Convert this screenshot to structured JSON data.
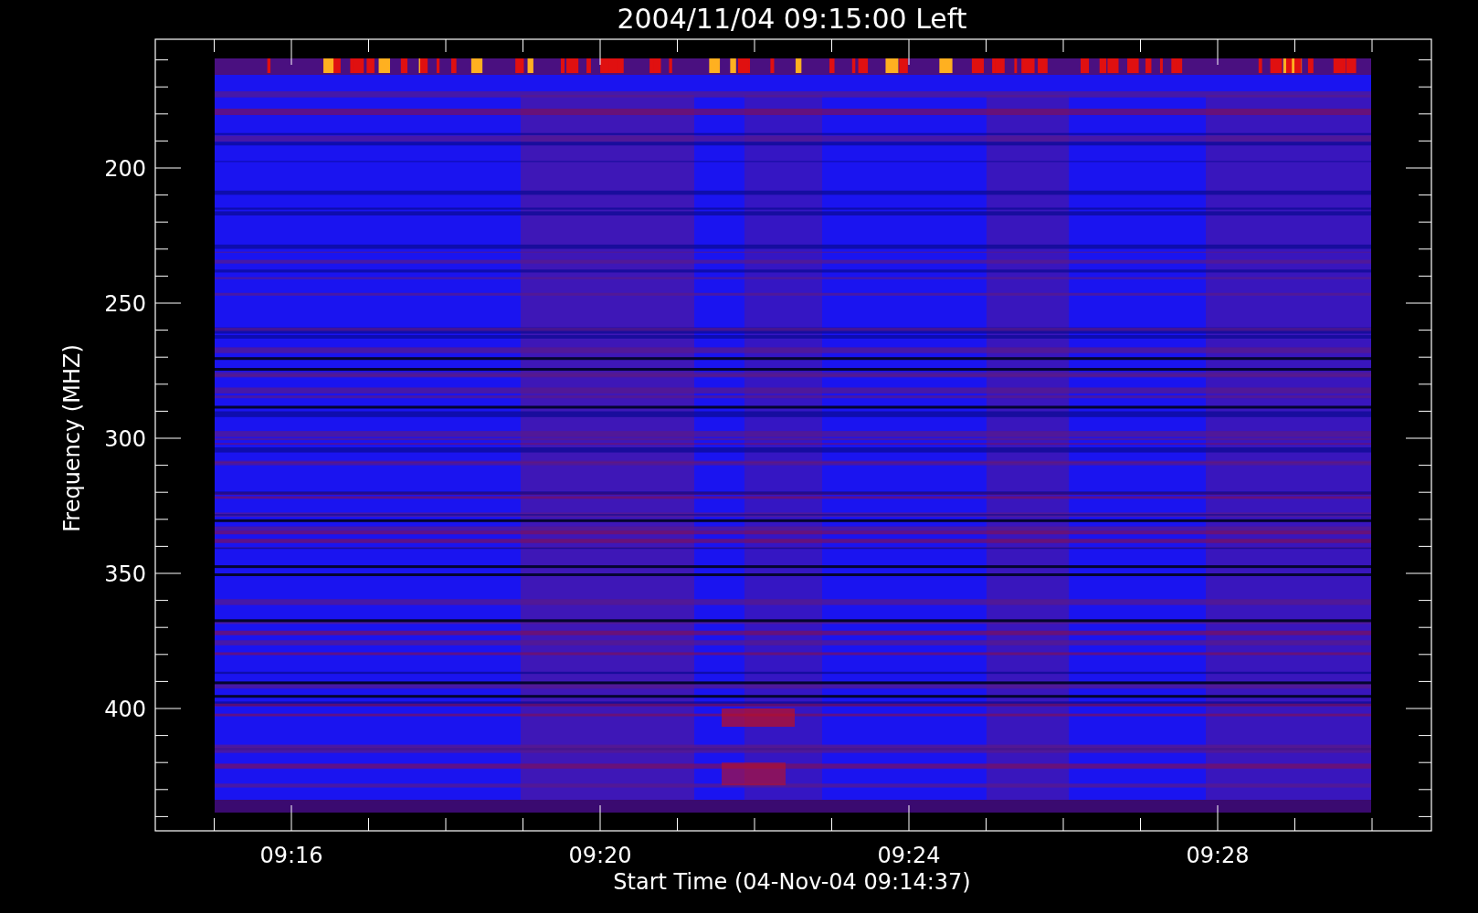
{
  "plot": {
    "title": "2004/11/04 09:15:00 Left",
    "y_label": "Frequency (MHZ)",
    "y_ticks": [
      "200",
      "250",
      "300",
      "350",
      "400"
    ],
    "x_ticks": [
      "09:16",
      "09:20",
      "09:24",
      "09:28"
    ],
    "x_label": "Start Time (04-Nov-04 09:14:37)"
  }
}
